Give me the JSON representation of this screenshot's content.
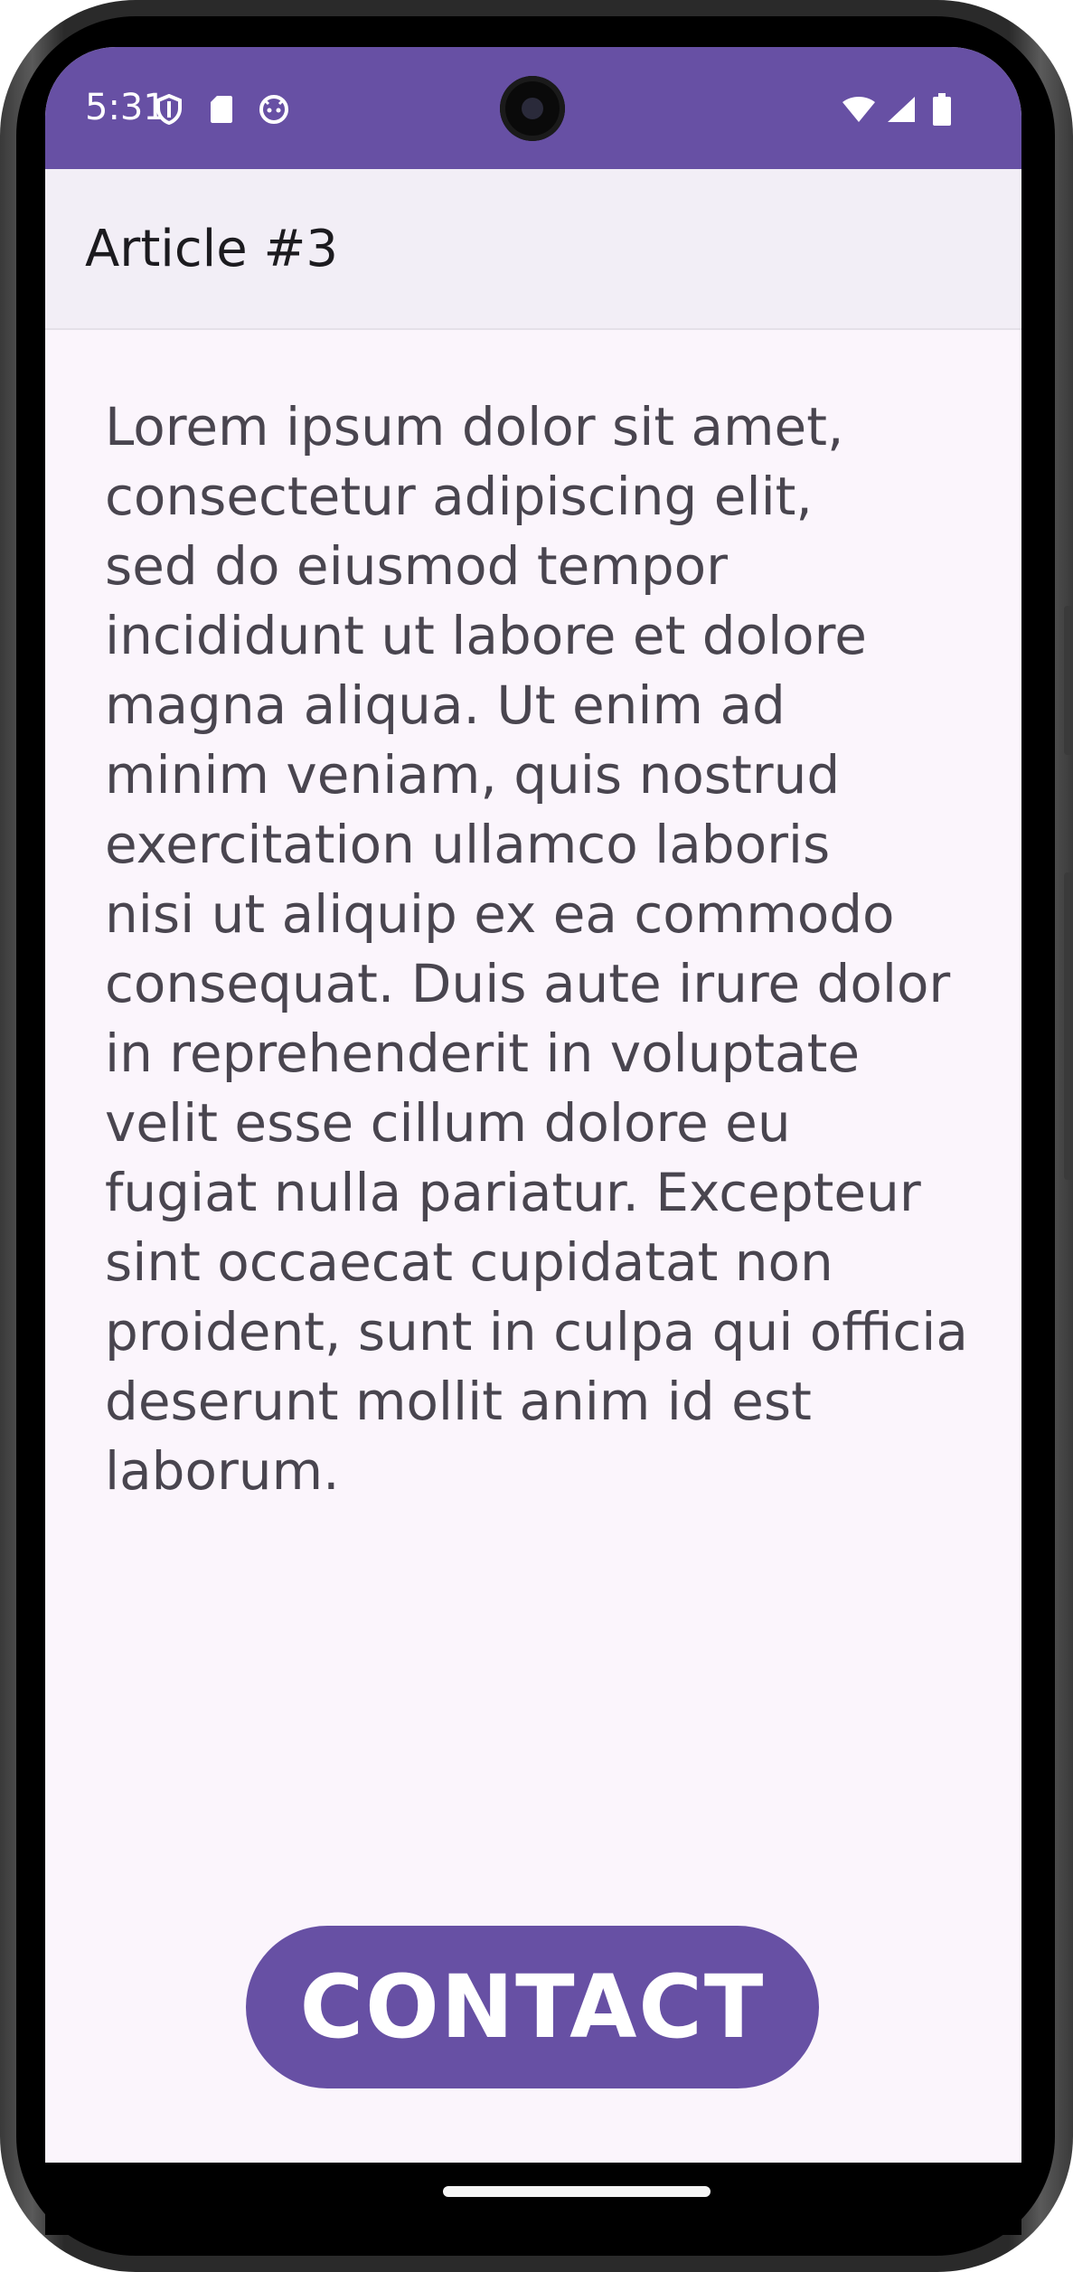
{
  "status_bar": {
    "time": "5:31",
    "left_icons": [
      "shield-icon",
      "sd-card-icon",
      "android-face-icon"
    ],
    "right_icons": [
      "wifi-icon",
      "cell-signal-icon",
      "battery-icon"
    ],
    "background_color": "#6750a4"
  },
  "app_bar": {
    "title": "Article #3"
  },
  "article": {
    "lines": [
      "Lorem ipsum dolor sit amet,",
      "consectetur adipiscing elit,",
      "sed do eiusmod tempor",
      "incididunt ut labore et dolore",
      "magna aliqua. Ut enim ad",
      "minim veniam, quis nostrud",
      "exercitation ullamco laboris",
      "nisi ut aliquip ex ea commodo",
      "consequat. Duis aute irure dolor",
      "in reprehenderit in voluptate",
      "velit esse cillum dolore eu",
      "fugiat nulla pariatur. Excepteur",
      "sint occaecat cupidatat non",
      "proident, sunt in culpa qui officia",
      "deserunt mollit anim id est",
      "laborum."
    ]
  },
  "contact_button": {
    "label": "CONTACT",
    "color": "#6750a4"
  }
}
